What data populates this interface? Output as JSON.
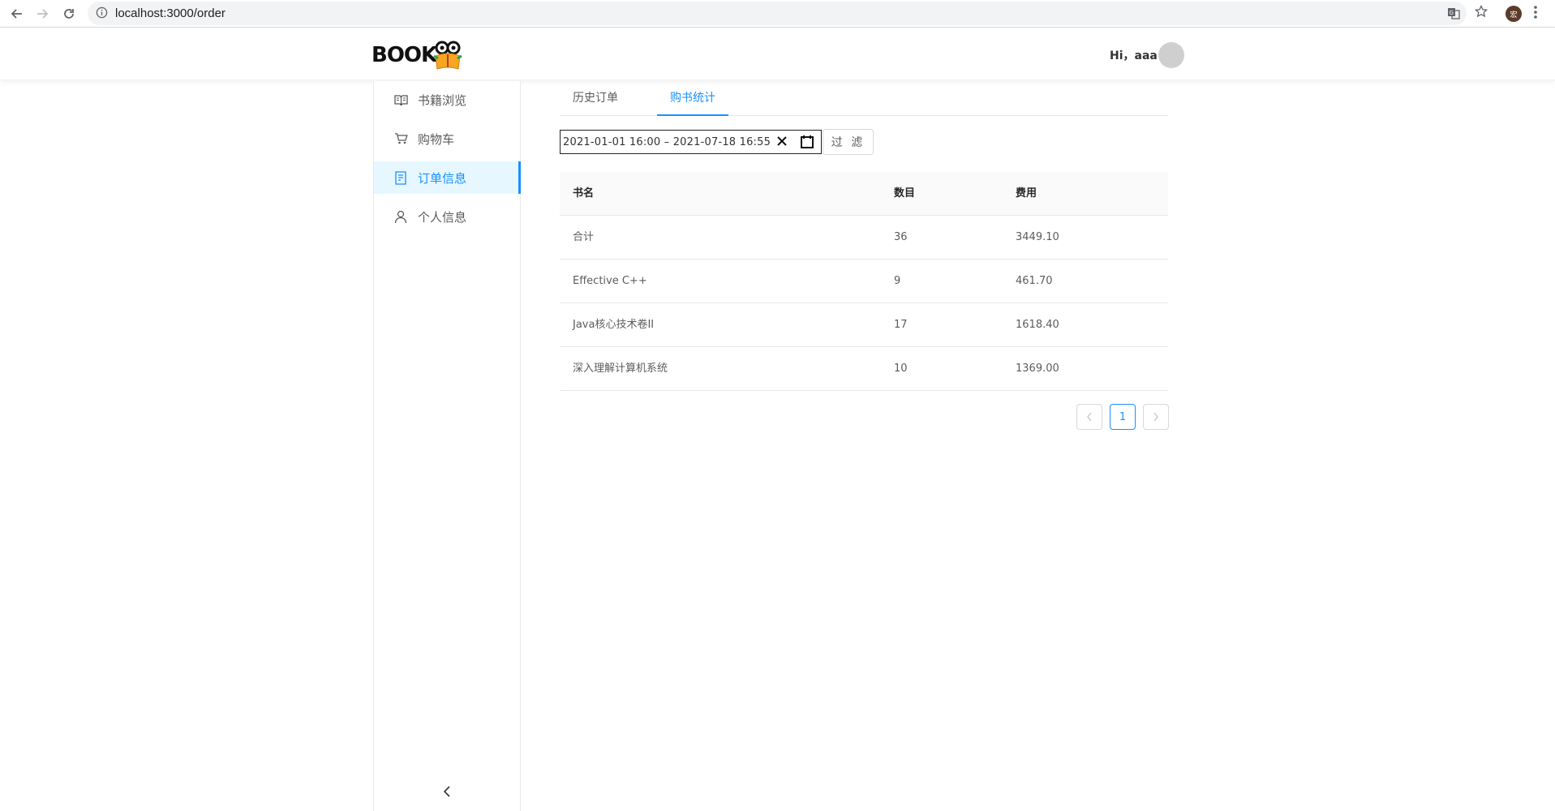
{
  "browser": {
    "url": "localhost:3000/order",
    "profile_initial": "宏"
  },
  "header": {
    "logo_text": "BOOK",
    "greeting": "Hi，aaa"
  },
  "sidebar": {
    "items": [
      {
        "label": "书籍浏览",
        "icon": "book-open-icon"
      },
      {
        "label": "购物车",
        "icon": "shopping-cart-icon"
      },
      {
        "label": "订单信息",
        "icon": "order-doc-icon",
        "active": true
      },
      {
        "label": "个人信息",
        "icon": "user-icon"
      }
    ],
    "collapse_icon": "chevron-left-icon"
  },
  "tabs": [
    {
      "label": "历史订单"
    },
    {
      "label": "购书统计",
      "active": true
    }
  ],
  "filter": {
    "range_text": "2021-01-01  16:00 – 2021-07-18  16:55",
    "button_label": "过 滤"
  },
  "table": {
    "columns": [
      "书名",
      "数目",
      "费用"
    ],
    "rows": [
      [
        "合计",
        "36",
        "3449.10"
      ],
      [
        "Effective C++",
        "9",
        "461.70"
      ],
      [
        "Java核心技术卷II",
        "17",
        "1618.40"
      ],
      [
        "深入理解计算机系统",
        "10",
        "1369.00"
      ]
    ]
  },
  "pagination": {
    "current": "1"
  },
  "colors": {
    "accent": "#1890ff",
    "active_bg": "#e6f7ff",
    "border": "#e8e8e8"
  }
}
